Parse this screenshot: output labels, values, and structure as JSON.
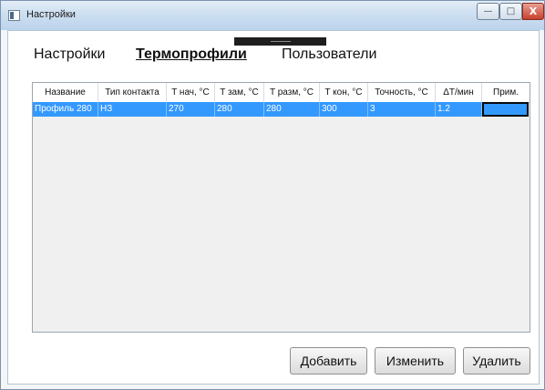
{
  "window": {
    "title": "Настройки",
    "controls": {
      "minimize": "—",
      "maximize": "□",
      "close": "X"
    }
  },
  "tabs": [
    {
      "label": "Настройки",
      "active": false
    },
    {
      "label": "Термопрофили",
      "active": true
    },
    {
      "label": "Пользователи",
      "active": false
    }
  ],
  "table": {
    "columns": [
      "Название",
      "Тип контакта",
      "T нач, °C",
      "T зам, °C",
      "T разм, °C",
      "T кон, °C",
      "Точность, °C",
      "ΔT/мин",
      "Прим."
    ],
    "rows": [
      [
        "Профиль 280",
        "НЗ",
        "270",
        "280",
        "280",
        "300",
        "3",
        "1.2",
        ""
      ]
    ],
    "selected_row_index": 0,
    "selection_color": "#3399ff"
  },
  "buttons": {
    "add": "Добавить",
    "edit": "Изменить",
    "delete": "Удалить"
  }
}
